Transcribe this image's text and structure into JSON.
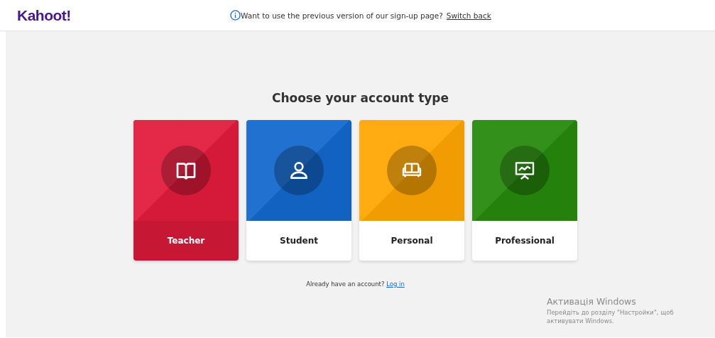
{
  "header": {
    "logo": "Kahoot!",
    "notice": "Want to use the previous version of our sign-up page?",
    "notice_link": "Switch back"
  },
  "title": "Choose your account type",
  "cards": [
    {
      "label": "Teacher",
      "kind": "book",
      "color": "#e21b3c",
      "selected": true
    },
    {
      "label": "Student",
      "kind": "person",
      "color": "#1368ce",
      "selected": false
    },
    {
      "label": "Personal",
      "kind": "sofa",
      "color": "#ffa602",
      "selected": false
    },
    {
      "label": "Professional",
      "kind": "presentation",
      "color": "#26890c",
      "selected": false
    }
  ],
  "login": {
    "text": "Already have an account?",
    "link": "Log in"
  },
  "os_overlay": {
    "title": "Активація Windows",
    "message": "Перейдіть до розділу \"Настройки\", щоб активувати Windows."
  }
}
